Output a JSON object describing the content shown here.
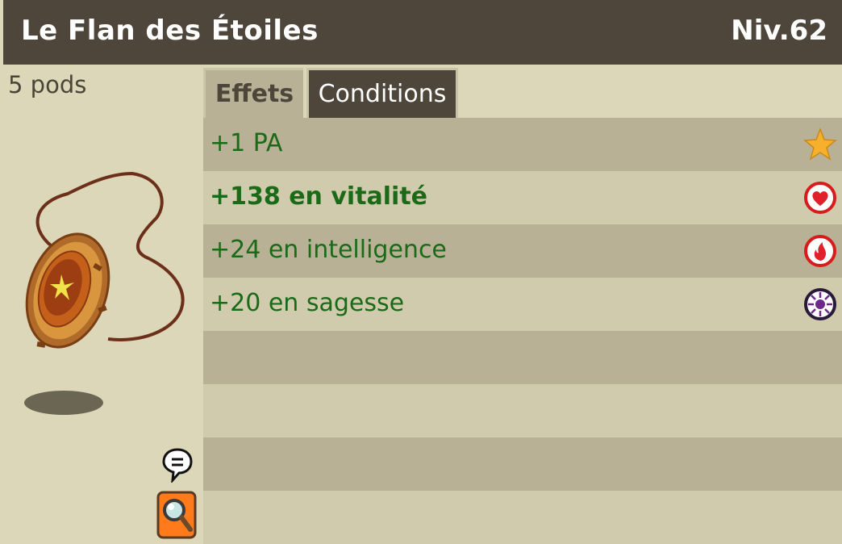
{
  "header": {
    "title": "Le Flan des Étoiles",
    "level": "Niv.62"
  },
  "item": {
    "weight": "5 pods"
  },
  "tabs": [
    {
      "label": "Effets",
      "active": true
    },
    {
      "label": "Conditions",
      "active": false
    }
  ],
  "effects": [
    {
      "text": "+1 PA",
      "icon": "star-icon",
      "bold": false
    },
    {
      "text": "+138 en vitalité",
      "icon": "heart-icon",
      "bold": true
    },
    {
      "text": "+24 en intelligence",
      "icon": "fire-icon",
      "bold": false
    },
    {
      "text": "+20 en sagesse",
      "icon": "wisdom-icon",
      "bold": false
    }
  ],
  "colors": {
    "header_bg": "#4e463b",
    "panel_bg": "#dcd7b8",
    "row_dark": "#b8b196",
    "row_light": "#d1cbae",
    "effect_text": "#1a6a18"
  }
}
